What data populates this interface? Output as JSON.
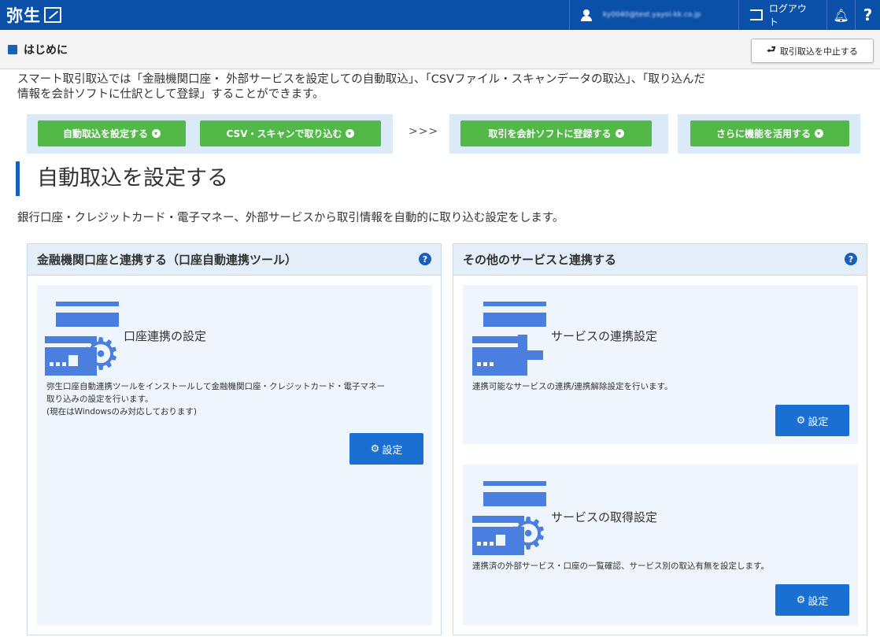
{
  "topbar": {
    "logo": "弥生",
    "user_email": "ky0040@test.yayoi-kk.co.jp",
    "logout_label": "ログアウト",
    "help_label": "?"
  },
  "subheader": {
    "title": "はじめに",
    "cancel_label": "取引取込を中止する"
  },
  "intro": {
    "line1": "スマート取引取込では「金融機関口座・ 外部サービスを設定しての自動取込」、「CSVファイル・スキャンデータの取込」、「取り込んだ",
    "line2": "情報を会計ソフトに仕訳として登録」することができます。"
  },
  "steps": {
    "auto": "自動取込を設定する",
    "csv": "CSV・スキャンで取り込む",
    "arrows": ">>>",
    "register": "取引を会計ソフトに登録する",
    "more": "さらに機能を活用する"
  },
  "section": {
    "heading": "自動取込を設定する",
    "description": "銀行口座・クレジットカード・電子マネー、外部サービスから取引情報を自動的に取り込む設定をします。"
  },
  "left_panel": {
    "title": "金融機関口座と連携する（口座自動連携ツール）",
    "card": {
      "title": "口座連携の設定",
      "desc1": "弥生口座自動連携ツールをインストールして金融機関口座・クレジットカード・電子マネー",
      "desc2": "取り込みの設定を行います。",
      "desc3": "(現在はWindowsのみ対応しております)",
      "button": "設定"
    }
  },
  "right_panel": {
    "title": "その他のサービスと連携する",
    "card1": {
      "title": "サービスの連携設定",
      "desc": "連携可能なサービスの連携/連携解除設定を行います。",
      "button": "設定"
    },
    "card2": {
      "title": "サービスの取得設定",
      "desc": "連携済の外部サービス・口座の一覧確認、サービス別の取込有無を設定します。",
      "button": "設定"
    }
  },
  "colors": {
    "header_blue": "#0a4fa8",
    "step_green": "#52b848",
    "button_blue": "#1a6fd2",
    "card_bg": "#eef5fc"
  }
}
